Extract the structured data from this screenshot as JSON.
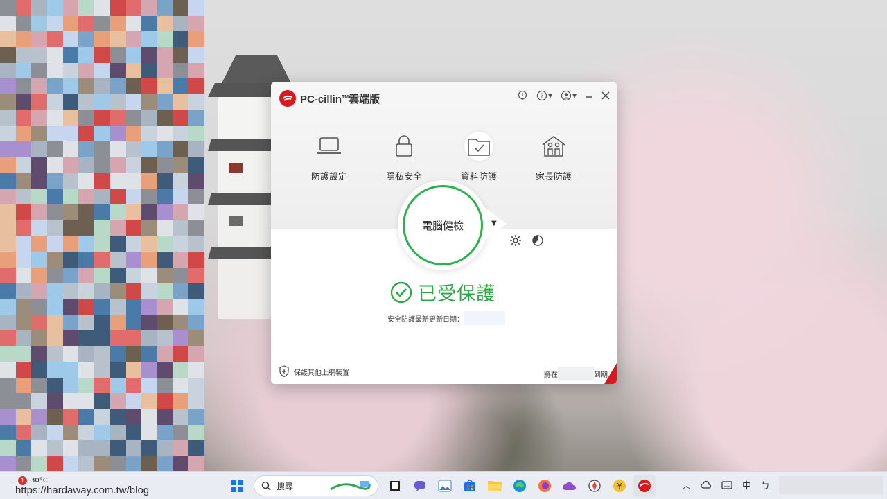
{
  "window": {
    "app_name": "PC-cillin",
    "app_tm": "TM",
    "app_edition": "雲端版",
    "features": [
      {
        "label": "防護設定",
        "icon": "laptop-icon"
      },
      {
        "label": "隱私安全",
        "icon": "lock-icon"
      },
      {
        "label": "資料防護",
        "icon": "folder-check-icon"
      },
      {
        "label": "家長防護",
        "icon": "family-icon"
      }
    ],
    "scan_label": "電腦健檢",
    "status_text": "已受保護",
    "update_label": "安全防護最新更新日期：",
    "protect_others_label": "保護其他上網裝置",
    "renew_prefix": "將在",
    "renew_suffix": "到期"
  },
  "taskbar": {
    "weather_temp": "30°C",
    "weather_badge": "1",
    "watermark": "https://hardaway.com.tw/blog",
    "search_placeholder": "搜尋",
    "tray_lang": "中",
    "tray_ime": "ㄅ"
  },
  "colors": {
    "brand_red": "#d71920",
    "protected_green": "#2aa845",
    "scan_ring": "#2bb24c"
  }
}
